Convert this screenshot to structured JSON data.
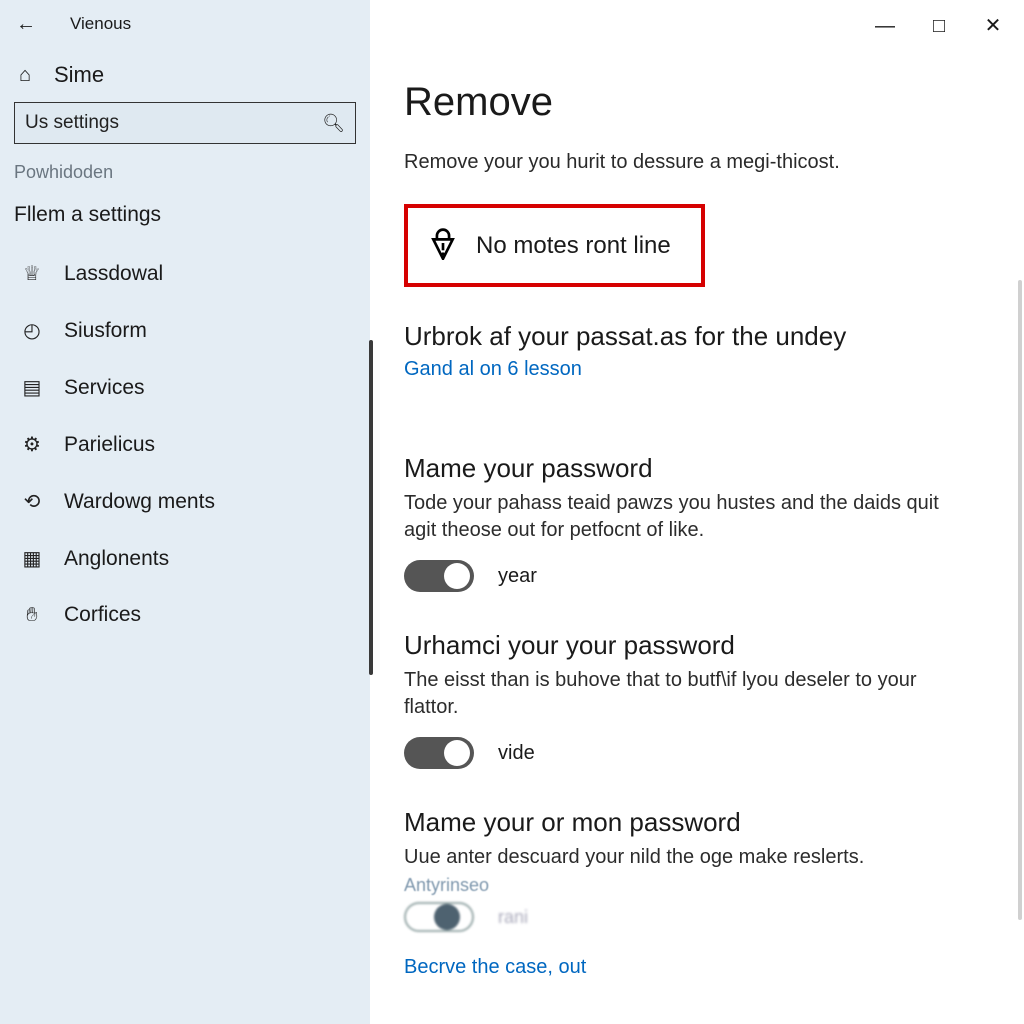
{
  "titlebar": {
    "app_name": "Vienous"
  },
  "sidebar": {
    "home_label": "Sime",
    "search_value": "Us settings",
    "muted_label": "Powhidoden",
    "section_title": "Fllem a settings",
    "items": [
      {
        "icon": "mic-icon",
        "label": "Lassdowal"
      },
      {
        "icon": "clock-icon",
        "label": "Siusform"
      },
      {
        "icon": "chat-icon",
        "label": "Services"
      },
      {
        "icon": "gear-icon",
        "label": "Parielicus"
      },
      {
        "icon": "widget-icon",
        "label": "Wardowg ments"
      },
      {
        "icon": "grid-icon",
        "label": "Anglonents"
      },
      {
        "icon": "hand-icon",
        "label": "Corfices"
      }
    ]
  },
  "main": {
    "heading": "Remove",
    "subtitle": "Remove your you hurit to dessure a megi-thicost.",
    "alert_text": "No motes ront line",
    "section1": {
      "title": "Urbrok af your passat.as for the undey",
      "link": "Gand al on 6 lesson"
    },
    "group1": {
      "title": "Mame your password",
      "desc": "Tode your pahass teaid pawzs you hustes and the daids quit agit theose out for petfocnt of like.",
      "toggle_label": "year"
    },
    "group2": {
      "title": "Urhamci your your password",
      "desc": "The eisst than is buhove that to butf\\if lyou deseler to your flattor.",
      "toggle_label": "vide"
    },
    "group3": {
      "title": "Mame your or mon password",
      "desc": "Uue anter descuard your nild the oge make reslerts.",
      "faded_label": "Antyrinseo",
      "toggle_label": "rani"
    },
    "bottom_link": "Becrve the case, out"
  }
}
